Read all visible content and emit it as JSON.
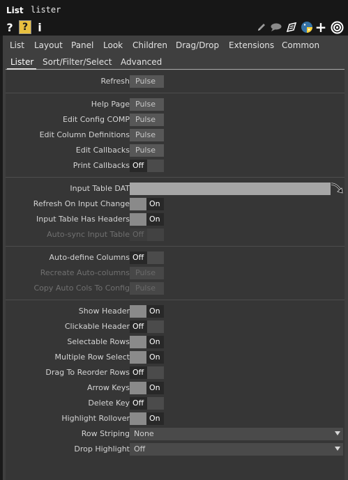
{
  "title": {
    "type": "List",
    "name": "lister"
  },
  "icons": {
    "help": "question-mark-icon",
    "op_help": "operator-help-icon",
    "info": "info-icon",
    "edit": "pencil-icon",
    "comment": "comment-icon",
    "clone": "clone-icon",
    "python": "python-icon",
    "add": "plus-icon",
    "target": "target-icon"
  },
  "icon_text": {
    "help": "?",
    "op_help": "?",
    "info": "i",
    "add": "+"
  },
  "pages": [
    "List",
    "Layout",
    "Panel",
    "Look",
    "Children",
    "Drag/Drop",
    "Extensions",
    "Common"
  ],
  "subpages": [
    "Lister",
    "Sort/Filter/Select",
    "Advanced"
  ],
  "params": [
    {
      "label": "Refresh",
      "type": "pulse",
      "value": "Pulse"
    },
    {
      "label": "Help Page",
      "type": "pulse",
      "value": "Pulse"
    },
    {
      "label": "Edit Config COMP",
      "type": "pulse",
      "value": "Pulse"
    },
    {
      "label": "Edit Column Definitions",
      "type": "pulse",
      "value": "Pulse"
    },
    {
      "label": "Edit Callbacks",
      "type": "pulse",
      "value": "Pulse"
    },
    {
      "label": "Print Callbacks",
      "type": "toggle",
      "value": "Off"
    },
    {
      "label": "Input Table DAT",
      "type": "dat",
      "value": ""
    },
    {
      "label": "Refresh On Input Change",
      "type": "toggle",
      "value": "On"
    },
    {
      "label": "Input Table Has Headers",
      "type": "toggle",
      "value": "On"
    },
    {
      "label": "Auto-sync Input Table",
      "type": "toggle",
      "value": "Off",
      "disabled": true
    },
    {
      "label": "Auto-define Columns",
      "type": "toggle",
      "value": "Off"
    },
    {
      "label": "Recreate Auto-columns",
      "type": "pulse",
      "value": "Pulse",
      "disabled": true
    },
    {
      "label": "Copy Auto Cols To Config",
      "type": "pulse",
      "value": "Pulse",
      "disabled": true
    },
    {
      "label": "Show Header",
      "type": "toggle",
      "value": "On"
    },
    {
      "label": "Clickable Header",
      "type": "toggle",
      "value": "Off"
    },
    {
      "label": "Selectable Rows",
      "type": "toggle",
      "value": "On"
    },
    {
      "label": "Multiple Row Select",
      "type": "toggle",
      "value": "On"
    },
    {
      "label": "Drag To Reorder Rows",
      "type": "toggle",
      "value": "Off"
    },
    {
      "label": "Arrow Keys",
      "type": "toggle",
      "value": "On"
    },
    {
      "label": "Delete Key",
      "type": "toggle",
      "value": "Off"
    },
    {
      "label": "Highlight Rollover",
      "type": "toggle",
      "value": "On"
    },
    {
      "label": "Row Striping",
      "type": "menu",
      "value": "None"
    },
    {
      "label": "Drop Highlight",
      "type": "menu",
      "value": "Off"
    }
  ],
  "colors": {
    "background": "#1a1a1a",
    "panel": "#3f3f3f",
    "param_area": "#363636",
    "pulse_button": "#575757",
    "toggle_on": "#8a8a8a",
    "dat_field": "#a6a6a6",
    "python_blue": "#3572A5",
    "python_yellow": "#FFD43B",
    "help_yellow": "#e8c040"
  }
}
